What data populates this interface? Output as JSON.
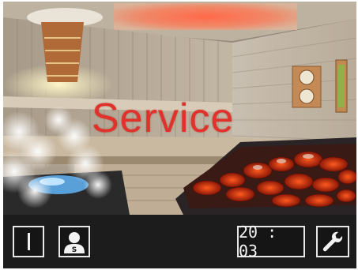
{
  "overlay": {
    "title": "Service"
  },
  "profile": {
    "letter": "S"
  },
  "clock": {
    "time": "20 : 03"
  },
  "icons": {
    "power": "power-icon",
    "profile": "user-profile-icon",
    "service": "wrench-icon"
  },
  "colors": {
    "service_text": "#e0322b",
    "bar_background": "#1c1c1c",
    "button_border": "#e8e8e8"
  }
}
